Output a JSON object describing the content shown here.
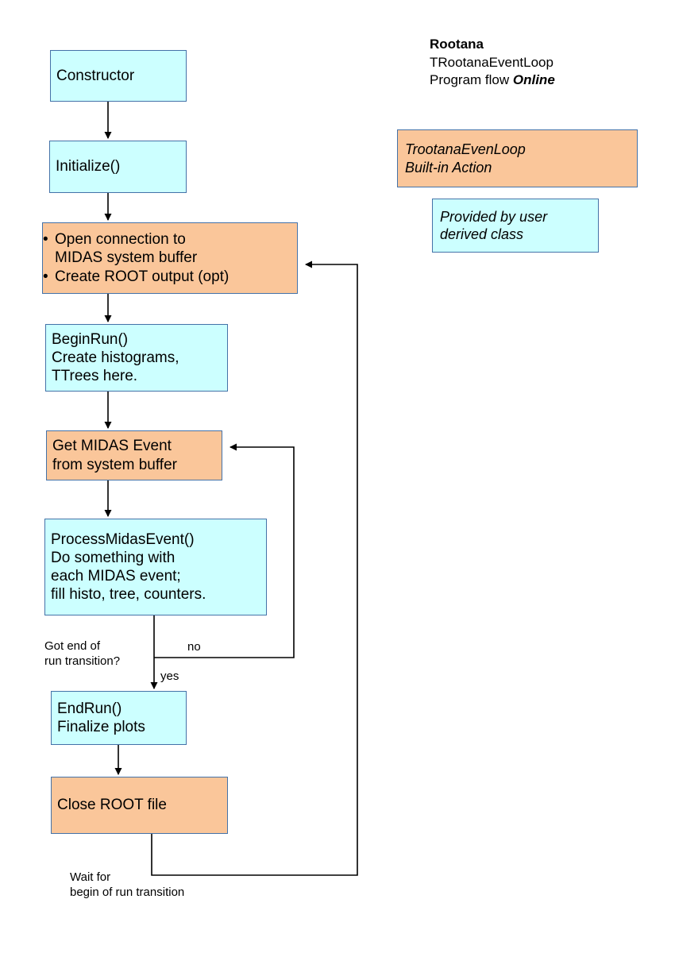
{
  "legend": {
    "title_line1": "Rootana",
    "title_line2": "TRootanaEventLoop",
    "title_line3_prefix": "Program flow ",
    "title_line3_emph": "Online",
    "builtin_box": "TrootanaEvenLoop\nBuilt-in Action",
    "user_box": "Provided by user\nderived class"
  },
  "colors": {
    "builtin_fill": "#fac69a",
    "user_fill": "#ccffff",
    "box_border": "#4472a8",
    "connector": "#000000",
    "text": "#000000"
  },
  "nodes": {
    "constructor": {
      "text": "Constructor",
      "kind": "user"
    },
    "initialize": {
      "text": "Initialize()",
      "kind": "user"
    },
    "open_connection": {
      "kind": "builtin",
      "bullets": [
        "Open connection to\nMIDAS system buffer",
        "Create ROOT output (opt)"
      ]
    },
    "begin_run": {
      "text": "BeginRun()\nCreate histograms,\nTTrees here.",
      "kind": "user"
    },
    "get_midas_event": {
      "text": "Get MIDAS Event\nfrom system buffer",
      "kind": "builtin"
    },
    "process_midas_event": {
      "text": "ProcessMidasEvent()\nDo something with\neach MIDAS event;\nfill histo, tree, counters.",
      "kind": "user"
    },
    "end_run": {
      "text": "EndRun()\nFinalize plots",
      "kind": "user"
    },
    "close_root_file": {
      "text": "Close ROOT file",
      "kind": "builtin"
    }
  },
  "labels": {
    "decision": "Got end of\nrun transition?",
    "branch_no": "no",
    "branch_yes": "yes",
    "wait": "Wait for\nbegin of run transition"
  }
}
